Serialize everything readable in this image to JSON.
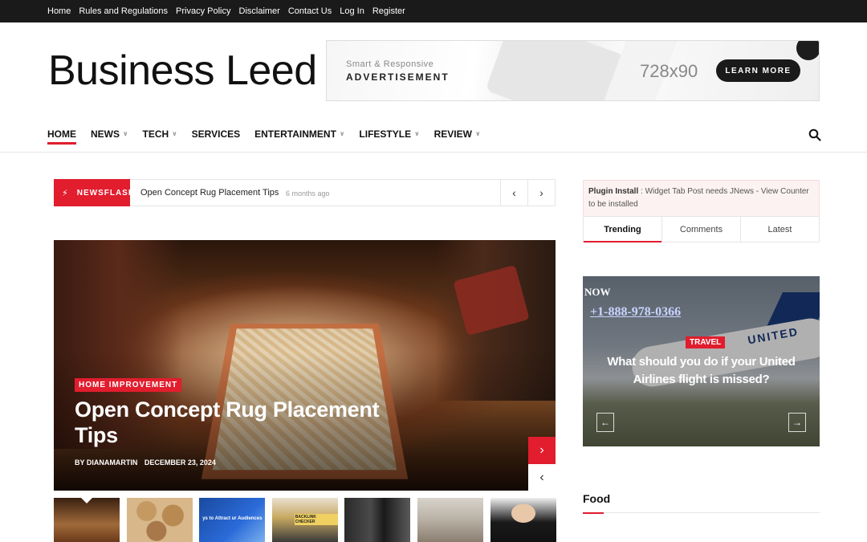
{
  "topbar": {
    "links": [
      "Home",
      "Rules and Regulations",
      "Privacy Policy",
      "Disclaimer",
      "Contact Us",
      "Log In",
      "Register"
    ]
  },
  "site": {
    "title": "Business Leed"
  },
  "ad": {
    "subtitle": "Smart & Responsive",
    "title": "ADVERTISEMENT",
    "size": "728x90",
    "button": "LEARN MORE"
  },
  "nav": {
    "items": [
      {
        "label": "HOME",
        "dropdown": false,
        "active": true
      },
      {
        "label": "NEWS",
        "dropdown": true
      },
      {
        "label": "TECH",
        "dropdown": true
      },
      {
        "label": "SERVICES",
        "dropdown": false
      },
      {
        "label": "ENTERTAINMENT",
        "dropdown": true
      },
      {
        "label": "LIFESTYLE",
        "dropdown": true
      },
      {
        "label": "REVIEW",
        "dropdown": true
      }
    ],
    "search_icon": "search-icon"
  },
  "newsflash": {
    "label": "NEWSFLASH",
    "title": "Open Concept Rug Placement Tips",
    "time": "6 months ago"
  },
  "hero": {
    "category": "HOME IMPROVEMENT",
    "title": "Open Concept Rug Placement Tips",
    "author": "BY DIANAMARTIN",
    "date": "DECEMBER 23, 2024"
  },
  "thumbs": {
    "t3_text": "ys to Attract ur Audiences",
    "t4_text": "BACKLINK CHECKER"
  },
  "sidebar": {
    "plugin_strong": "Plugin Install",
    "plugin_text": " : Widget Tab Post needs JNews - View Counter to be installed",
    "tabs": [
      "Trending",
      "Comments",
      "Latest"
    ],
    "card": {
      "overlay_now": "NOW",
      "overlay_phone": "+1-888-978-0366",
      "category": "TRAVEL",
      "title": "What should you do if your United Airlines flight is missed?",
      "plane_text": "UNITED"
    },
    "section_title": "Food"
  },
  "colors": {
    "accent": "#e11d2e",
    "topbar": "#1a1a1a"
  }
}
